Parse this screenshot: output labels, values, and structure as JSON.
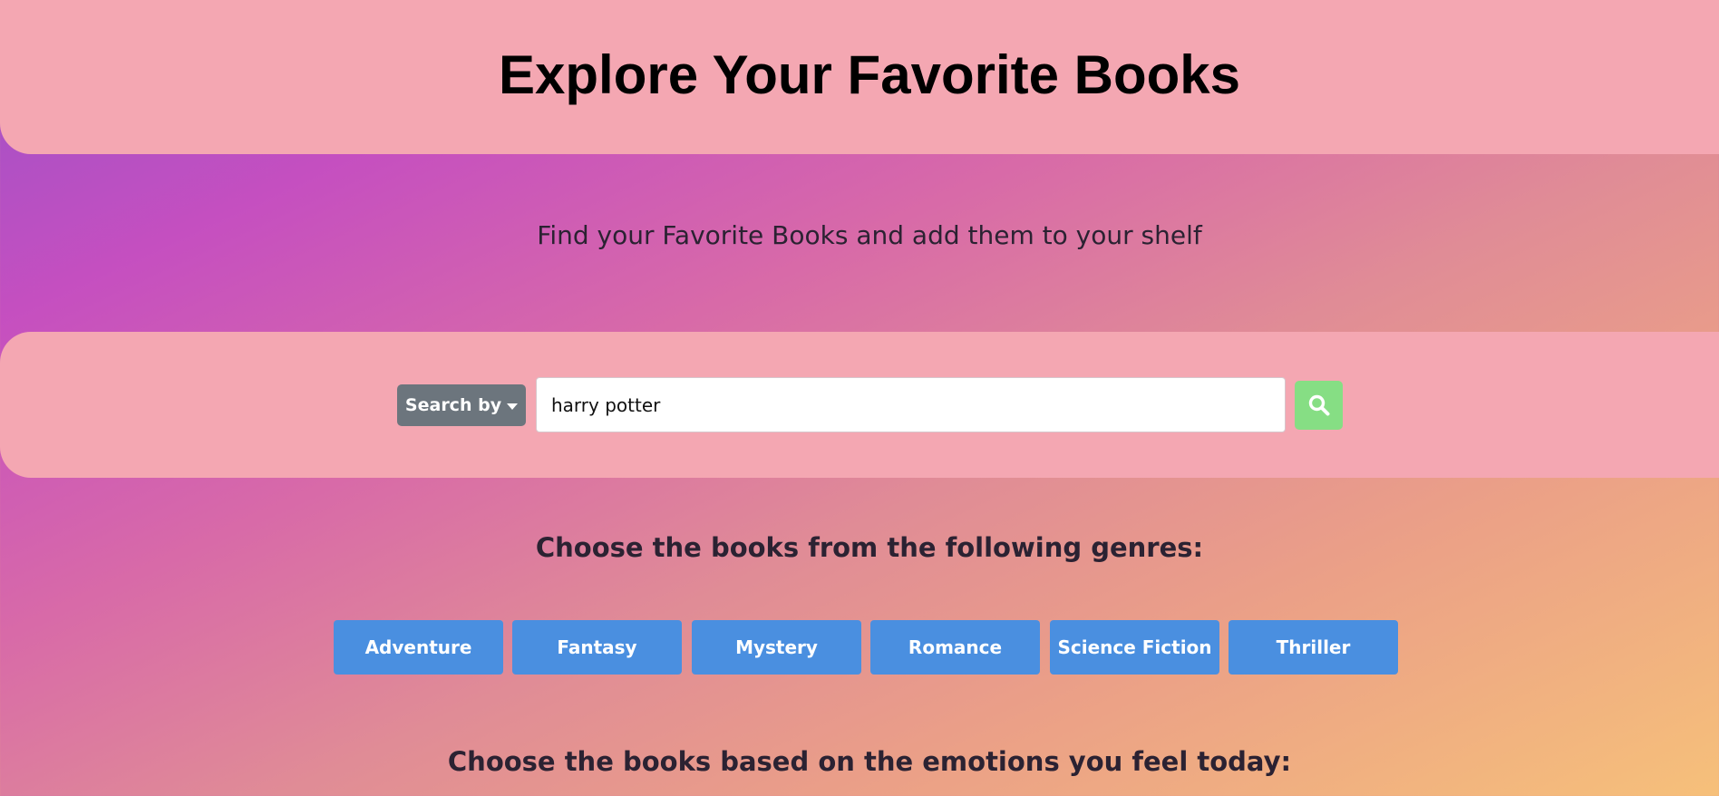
{
  "header": {
    "title": "Explore Your Favorite Books"
  },
  "subtitle": "Find your Favorite Books and add them to your shelf",
  "search": {
    "search_by_label": "Search by",
    "query_value": "harry potter",
    "submit_icon": "search-icon"
  },
  "genres": {
    "heading": "Choose the books from the following genres:",
    "items": [
      "Adventure",
      "Fantasy",
      "Mystery",
      "Romance",
      "Science Fiction",
      "Thriller"
    ]
  },
  "emotions": {
    "heading": "Choose the books based on the emotions you feel today:"
  },
  "colors": {
    "panel": "#f4a7b2",
    "genre_button": "#4a8fe0",
    "search_by_button": "#6c757d",
    "search_submit": "#86de84"
  }
}
